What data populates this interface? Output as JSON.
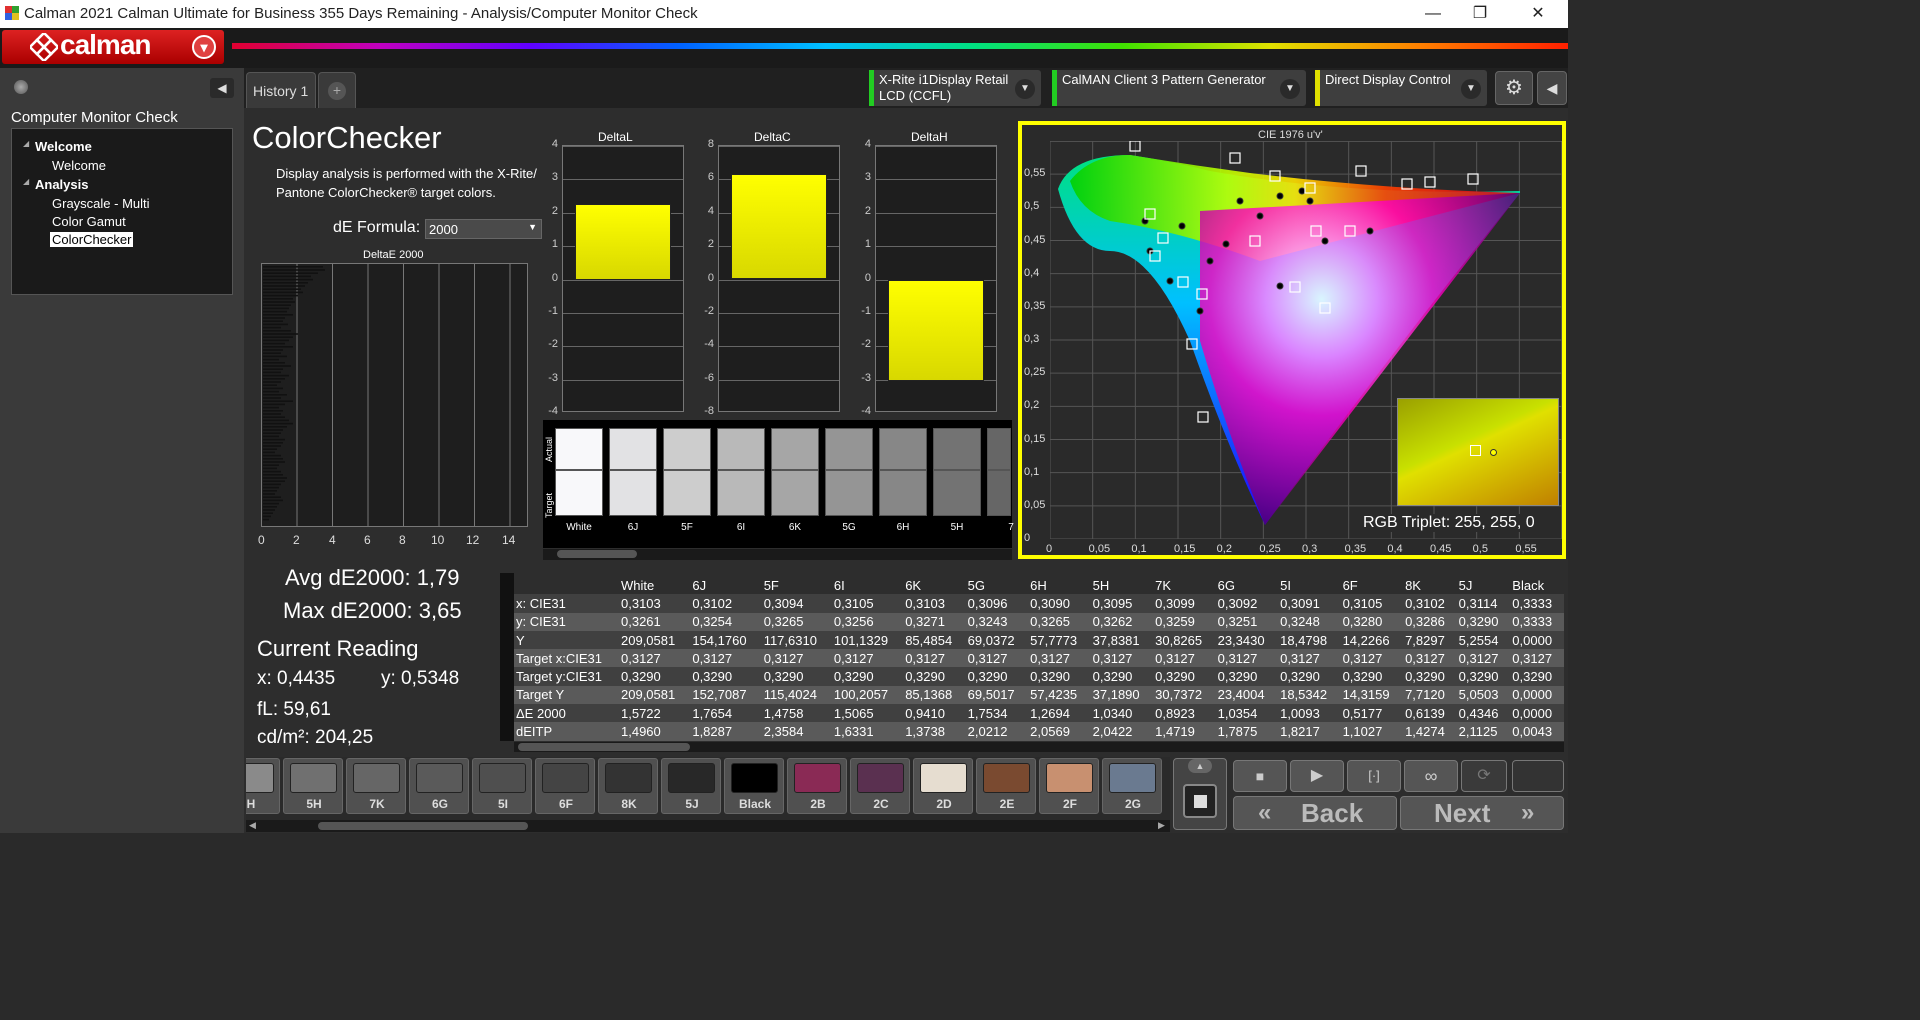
{
  "window": {
    "title": "Calman 2021 Calman Ultimate for Business 355 Days Remaining  - Analysis/Computer Monitor Check",
    "minimize": "—",
    "maximize": "❐",
    "close": "✕"
  },
  "header": {
    "logo_text": "calman",
    "menu_arrow": "▾"
  },
  "left_panel": {
    "workflow_title": "Computer Monitor Check",
    "tree": [
      {
        "label": "Welcome",
        "level": 0,
        "bold": true
      },
      {
        "label": "Welcome",
        "level": 1,
        "bold": false
      },
      {
        "label": "Analysis",
        "level": 0,
        "bold": true
      },
      {
        "label": "Grayscale - Multi",
        "level": 1,
        "bold": false
      },
      {
        "label": "Color Gamut",
        "level": 1,
        "bold": false
      },
      {
        "label": "ColorChecker",
        "level": 1,
        "bold": false,
        "selected": true
      }
    ]
  },
  "tabs": {
    "history": "History 1",
    "add": "+"
  },
  "devices": {
    "meter": "X-Rite i1Display Retail\nLCD (CCFL)",
    "meter_line1": "X-Rite i1Display Retail",
    "meter_line2": "LCD (CCFL)",
    "generator": "CalMAN Client 3 Pattern Generator",
    "display": "Direct Display Control",
    "meter_color": "#22cc22",
    "generator_color": "#22cc22",
    "display_color": "#e0e000"
  },
  "page": {
    "title": "ColorChecker",
    "description_line1": "Display analysis is performed with the X-Rite/",
    "description_line2": "Pantone ColorChecker® target colors.",
    "formula_label": "dE Formula:",
    "formula_value": "2000"
  },
  "delta_charts": {
    "deltaE": {
      "title": "DeltaE 2000",
      "xticks": [
        "0",
        "2",
        "4",
        "6",
        "8",
        "10",
        "12",
        "14"
      ]
    },
    "deltaL": {
      "title": "DeltaL",
      "yticks": [
        "4",
        "3",
        "2",
        "1",
        "0",
        "-1",
        "-2",
        "-3",
        "-4"
      ],
      "value": 2.25
    },
    "deltaC": {
      "title": "DeltaC",
      "yticks": [
        "8",
        "6",
        "4",
        "2",
        "0",
        "-2",
        "-4",
        "-6",
        "-8"
      ],
      "value": 6.3
    },
    "deltaH": {
      "title": "DeltaH",
      "yticks": [
        "4",
        "3",
        "2",
        "1",
        "0",
        "-1",
        "-2",
        "-3",
        "-4"
      ],
      "value": -3.05
    }
  },
  "swatches": {
    "actual_label": "Actual",
    "target_label": "Target",
    "items": [
      {
        "name": "White",
        "color": "#f8f8fa"
      },
      {
        "name": "6J",
        "color": "#e2e2e4"
      },
      {
        "name": "5F",
        "color": "#cdcdcd"
      },
      {
        "name": "6I",
        "color": "#b9b9b9"
      },
      {
        "name": "6K",
        "color": "#a6a6a6"
      },
      {
        "name": "5G",
        "color": "#959595"
      },
      {
        "name": "6H",
        "color": "#878787"
      },
      {
        "name": "5H",
        "color": "#737373"
      },
      {
        "name": "7",
        "color": "#666666"
      }
    ]
  },
  "stats": {
    "avg": "Avg dE2000: 1,79",
    "max": "Max dE2000: 3,65",
    "current_reading": "Current Reading",
    "x": "x: 0,4435",
    "y": "y: 0,5348",
    "fl": "fL: 59,61",
    "cdm2": "cd/m²: 204,25"
  },
  "table": {
    "columns": [
      "White",
      "6J",
      "5F",
      "6I",
      "6K",
      "5G",
      "6H",
      "5H",
      "7K",
      "6G",
      "5I",
      "6F",
      "8K",
      "5J",
      "Black"
    ],
    "rows": [
      {
        "label": "x: CIE31",
        "values": [
          "0,3103",
          "0,3102",
          "0,3094",
          "0,3105",
          "0,3103",
          "0,3096",
          "0,3090",
          "0,3095",
          "0,3099",
          "0,3092",
          "0,3091",
          "0,3105",
          "0,3102",
          "0,3114",
          "0,3333"
        ]
      },
      {
        "label": "y: CIE31",
        "values": [
          "0,3261",
          "0,3254",
          "0,3265",
          "0,3256",
          "0,3271",
          "0,3243",
          "0,3265",
          "0,3262",
          "0,3259",
          "0,3251",
          "0,3248",
          "0,3280",
          "0,3286",
          "0,3290",
          "0,3333"
        ]
      },
      {
        "label": "Y",
        "values": [
          "209,0581",
          "154,1760",
          "117,6310",
          "101,1329",
          "85,4854",
          "69,0372",
          "57,7773",
          "37,8381",
          "30,8265",
          "23,3430",
          "18,4798",
          "14,2266",
          "7,8297",
          "5,2554",
          "0,0000"
        ]
      },
      {
        "label": "Target x:CIE31",
        "values": [
          "0,3127",
          "0,3127",
          "0,3127",
          "0,3127",
          "0,3127",
          "0,3127",
          "0,3127",
          "0,3127",
          "0,3127",
          "0,3127",
          "0,3127",
          "0,3127",
          "0,3127",
          "0,3127",
          "0,3127"
        ]
      },
      {
        "label": "Target y:CIE31",
        "values": [
          "0,3290",
          "0,3290",
          "0,3290",
          "0,3290",
          "0,3290",
          "0,3290",
          "0,3290",
          "0,3290",
          "0,3290",
          "0,3290",
          "0,3290",
          "0,3290",
          "0,3290",
          "0,3290",
          "0,3290"
        ]
      },
      {
        "label": "Target Y",
        "values": [
          "209,0581",
          "152,7087",
          "115,4024",
          "100,2057",
          "85,1368",
          "69,5017",
          "57,4235",
          "37,1890",
          "30,7372",
          "23,4004",
          "18,5342",
          "14,3159",
          "7,7120",
          "5,0503",
          "0,0000"
        ]
      },
      {
        "label": "ΔE 2000",
        "values": [
          "1,5722",
          "1,7654",
          "1,4758",
          "1,5065",
          "0,9410",
          "1,7534",
          "1,2694",
          "1,0340",
          "0,8923",
          "1,0354",
          "1,0093",
          "0,5177",
          "0,6139",
          "0,4346",
          "0,0000"
        ]
      },
      {
        "label": "dEITP",
        "values": [
          "1,4960",
          "1,8287",
          "2,3584",
          "1,6331",
          "1,3738",
          "2,0212",
          "2,0569",
          "2,0422",
          "1,4719",
          "1,7875",
          "1,8217",
          "1,1027",
          "1,4274",
          "2,1125",
          "0,0043"
        ]
      }
    ]
  },
  "cie": {
    "title": "CIE 1976 u'v'",
    "xticks": [
      "0",
      "0,05",
      "0,1",
      "0,15",
      "0,2",
      "0,25",
      "0,3",
      "0,35",
      "0,4",
      "0,45",
      "0,5",
      "0,55"
    ],
    "yticks": [
      "0,55",
      "0,5",
      "0,45",
      "0,4",
      "0,35",
      "0,3",
      "0,25",
      "0,2",
      "0,15",
      "0,1",
      "0,05",
      "0"
    ],
    "rgb_triplet": "RGB Triplet: 255, 255, 0"
  },
  "bottom_swatches": [
    {
      "name": "H",
      "color": "#8a8a8a"
    },
    {
      "name": "5H",
      "color": "#707070"
    },
    {
      "name": "7K",
      "color": "#666666"
    },
    {
      "name": "6G",
      "color": "#5a5a5a"
    },
    {
      "name": "5I",
      "color": "#4f4f4f"
    },
    {
      "name": "6F",
      "color": "#444444"
    },
    {
      "name": "8K",
      "color": "#333333"
    },
    {
      "name": "5J",
      "color": "#282828"
    },
    {
      "name": "Black",
      "color": "#000000"
    },
    {
      "name": "2B",
      "color": "#8a2a55"
    },
    {
      "name": "2C",
      "color": "#5a3050"
    },
    {
      "name": "2D",
      "color": "#e6ddd0"
    },
    {
      "name": "2E",
      "color": "#7a4a30"
    },
    {
      "name": "2F",
      "color": "#c89070"
    },
    {
      "name": "2G",
      "color": "#6a7a90"
    }
  ],
  "controls": {
    "back": "Back",
    "next": "Next",
    "back_icon": "«",
    "next_icon": "»"
  }
}
